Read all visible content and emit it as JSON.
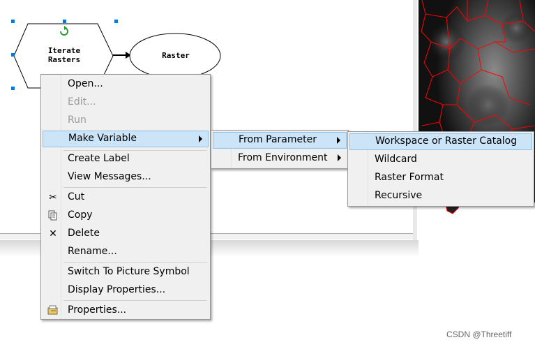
{
  "nodes": {
    "iterate_line1": "Iterate",
    "iterate_line2": "Rasters",
    "raster": "Raster"
  },
  "main_menu": {
    "items": [
      {
        "label": "Open...",
        "enabled": true
      },
      {
        "label": "Edit...",
        "enabled": false
      },
      {
        "label": "Run",
        "enabled": false
      },
      {
        "label": "Make Variable",
        "enabled": true,
        "submenu": true,
        "highlighted": true
      },
      {
        "label": "Create Label",
        "enabled": true
      },
      {
        "label": "View Messages...",
        "enabled": true
      },
      {
        "label": "Cut",
        "icon": "scissors-icon"
      },
      {
        "label": "Copy",
        "icon": "copy-icon"
      },
      {
        "label": "Delete",
        "icon": "delete-x-icon"
      },
      {
        "label": "Rename..."
      },
      {
        "label": "Switch To Picture Symbol"
      },
      {
        "label": "Display Properties..."
      },
      {
        "label": "Properties...",
        "icon": "properties-icon"
      }
    ]
  },
  "sub_menu": {
    "items": [
      {
        "label": "From Parameter",
        "highlighted": true
      },
      {
        "label": "From Environment"
      }
    ]
  },
  "param_menu": {
    "items": [
      {
        "label": "Workspace or Raster Catalog",
        "highlighted": true
      },
      {
        "label": "Wildcard"
      },
      {
        "label": "Raster Format"
      },
      {
        "label": "Recursive"
      }
    ]
  },
  "watermark": "CSDN @Threetiff",
  "colors": {
    "highlight": "#cce4f7",
    "selection_handle": "#0a7ad6",
    "boundary": "#ff0000"
  }
}
